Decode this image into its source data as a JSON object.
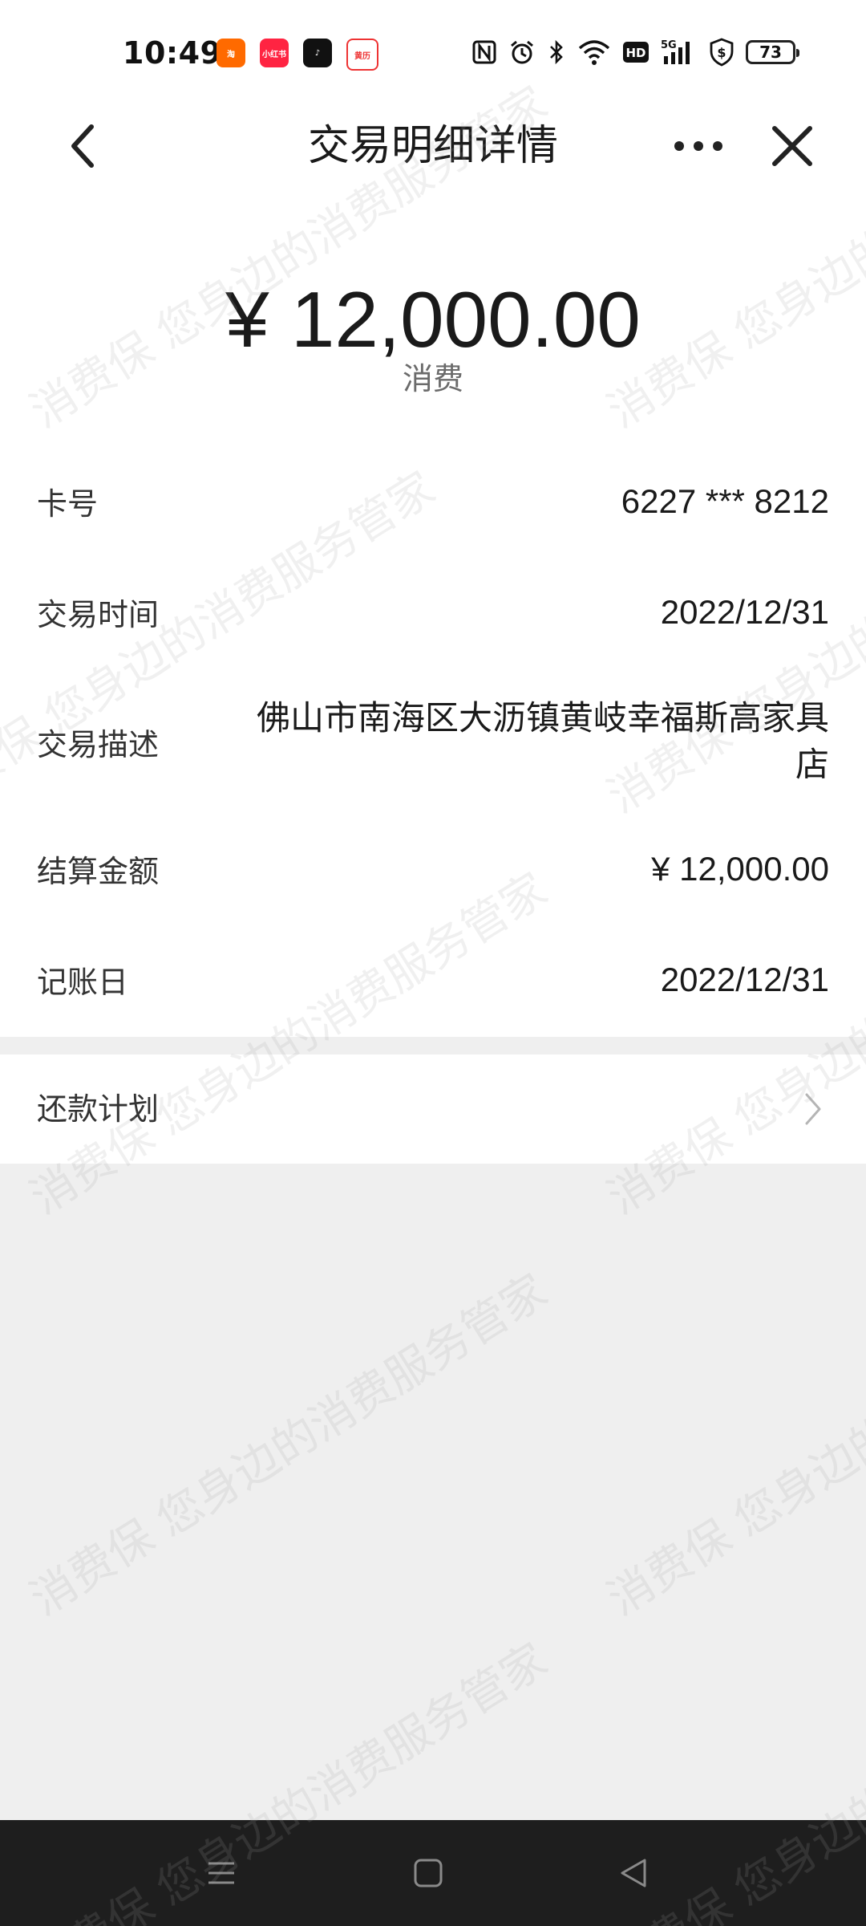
{
  "status_bar": {
    "time": "10:49",
    "battery": "73",
    "apps": [
      {
        "name": "alipay-icon",
        "label": "淘"
      },
      {
        "name": "xiaohongshu-icon",
        "label": "小红书"
      },
      {
        "name": "douyin-icon",
        "label": "♪"
      },
      {
        "name": "calendar-app-icon",
        "label": "黄历"
      }
    ],
    "indicators": [
      "nfc-icon",
      "alarm-icon",
      "bluetooth-icon",
      "wifi-icon",
      "hd-icon",
      "5g-signal-icon",
      "shield-dollar-icon"
    ]
  },
  "header": {
    "title": "交易明细详情"
  },
  "transaction": {
    "amount": "¥ 12,000.00",
    "type": "消费",
    "rows": [
      {
        "label": "卡号",
        "value": "6227 *** 8212"
      },
      {
        "label": "交易时间",
        "value": "2022/12/31"
      },
      {
        "label": "交易描述",
        "value": "佛山市南海区大沥镇黄岐幸福斯高家具店"
      },
      {
        "label": "结算金额",
        "value": "¥ 12,000.00"
      },
      {
        "label": "记账日",
        "value": "2022/12/31"
      }
    ]
  },
  "repay_plan": {
    "label": "还款计划"
  },
  "watermark": {
    "text": "消费保 您身边的消费服务管家"
  },
  "colors": {
    "page_bg": "#efefef",
    "card_bg": "#ffffff",
    "nav_bar_bg": "#1e1e1e"
  }
}
